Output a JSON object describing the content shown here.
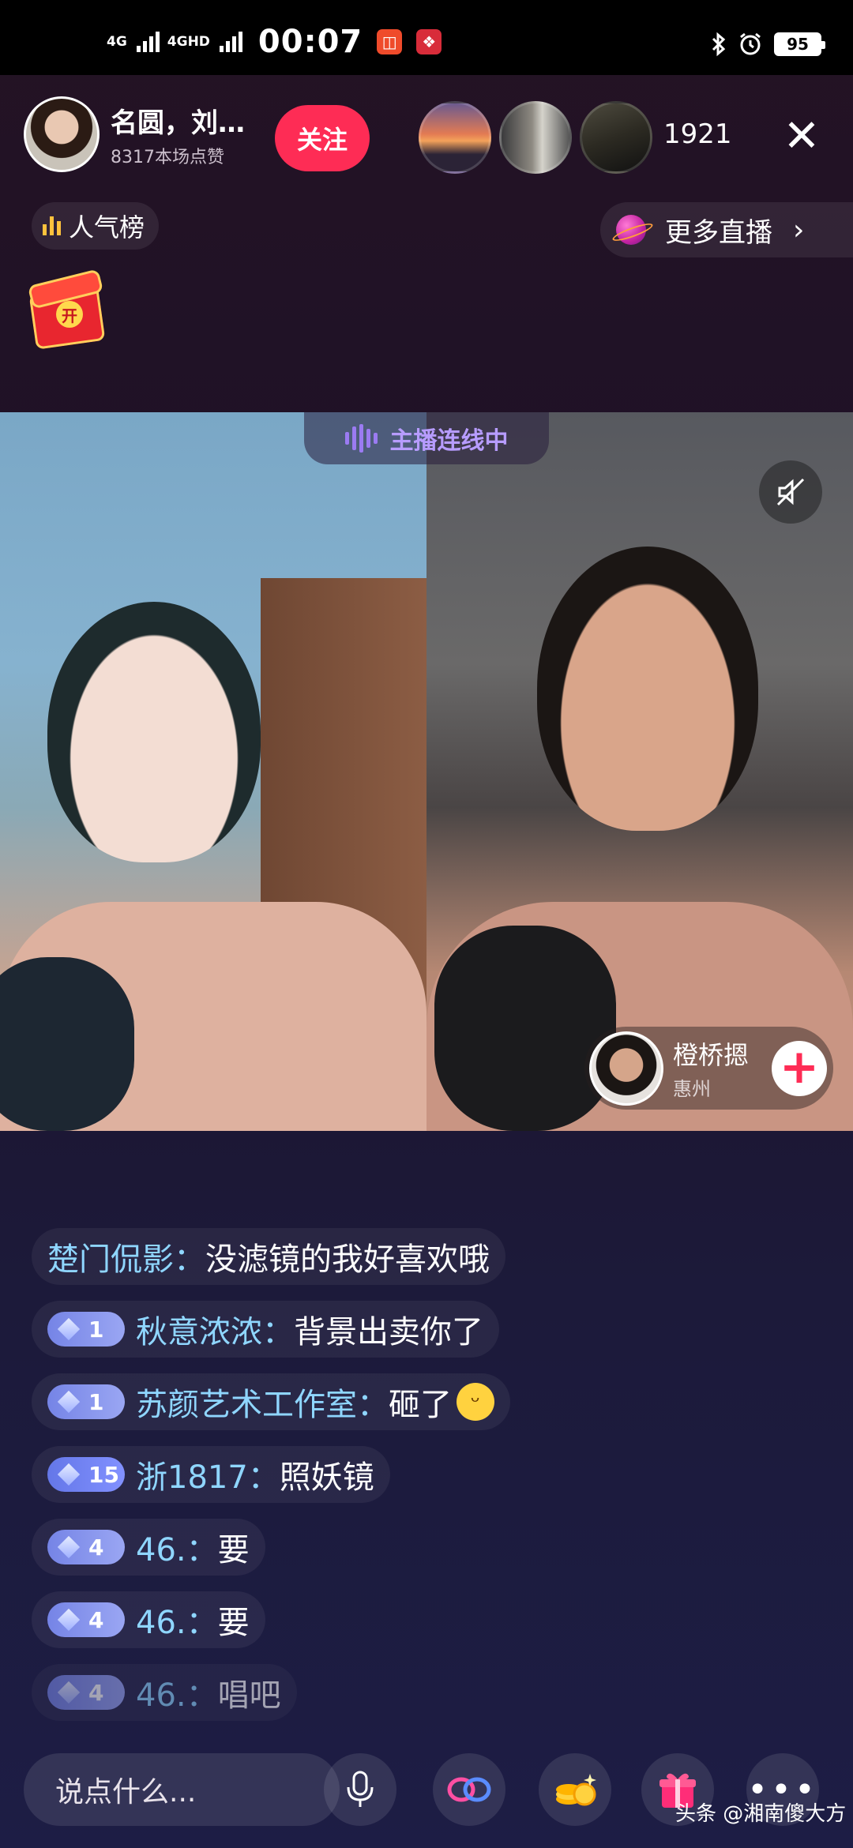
{
  "status_bar": {
    "network_1": "4G",
    "network_2": "4GHD",
    "time": "00:07",
    "battery": "95",
    "icons": [
      "bluetooth-icon",
      "alarm-icon"
    ]
  },
  "host": {
    "name": "名圆，刘…",
    "likes": "8317本场点赞",
    "follow_label": "关注"
  },
  "viewers": {
    "count": "1921"
  },
  "top_controls": {
    "close_glyph": "✕",
    "ranking_label": "人气榜",
    "more_live_label": "更多直播",
    "more_live_chevron": "›"
  },
  "red_packet": {
    "coin_label": "开"
  },
  "connection": {
    "label": "主播连线中"
  },
  "guest": {
    "name": "橙桥摁",
    "city": "惠州",
    "add_glyph": "+"
  },
  "comments": [
    {
      "level": "",
      "user": "楚门侃影：",
      "text": "没滤镜的我好喜欢哦"
    },
    {
      "level": "1",
      "user": "秋意浓浓：",
      "text": "背景出卖你了"
    },
    {
      "level": "1",
      "user": "苏颜艺术工作室：",
      "text": "砸了",
      "emoji": "grinning-emoji"
    },
    {
      "level": "15",
      "user": "浙1817：",
      "text": "照妖镜"
    },
    {
      "level": "4",
      "user": "46.：",
      "text": "要"
    },
    {
      "level": "4",
      "user": "46.：",
      "text": "要"
    },
    {
      "level": "4",
      "user": "46.：",
      "text": "唱吧"
    }
  ],
  "bottom_bar": {
    "input_placeholder": "说点什么...",
    "more_glyph": "•••"
  },
  "watermark": "头条 @湘南傻大方",
  "colors": {
    "accent": "#fe2c55",
    "username": "#8fd6ff",
    "connect": "#b79cff"
  }
}
